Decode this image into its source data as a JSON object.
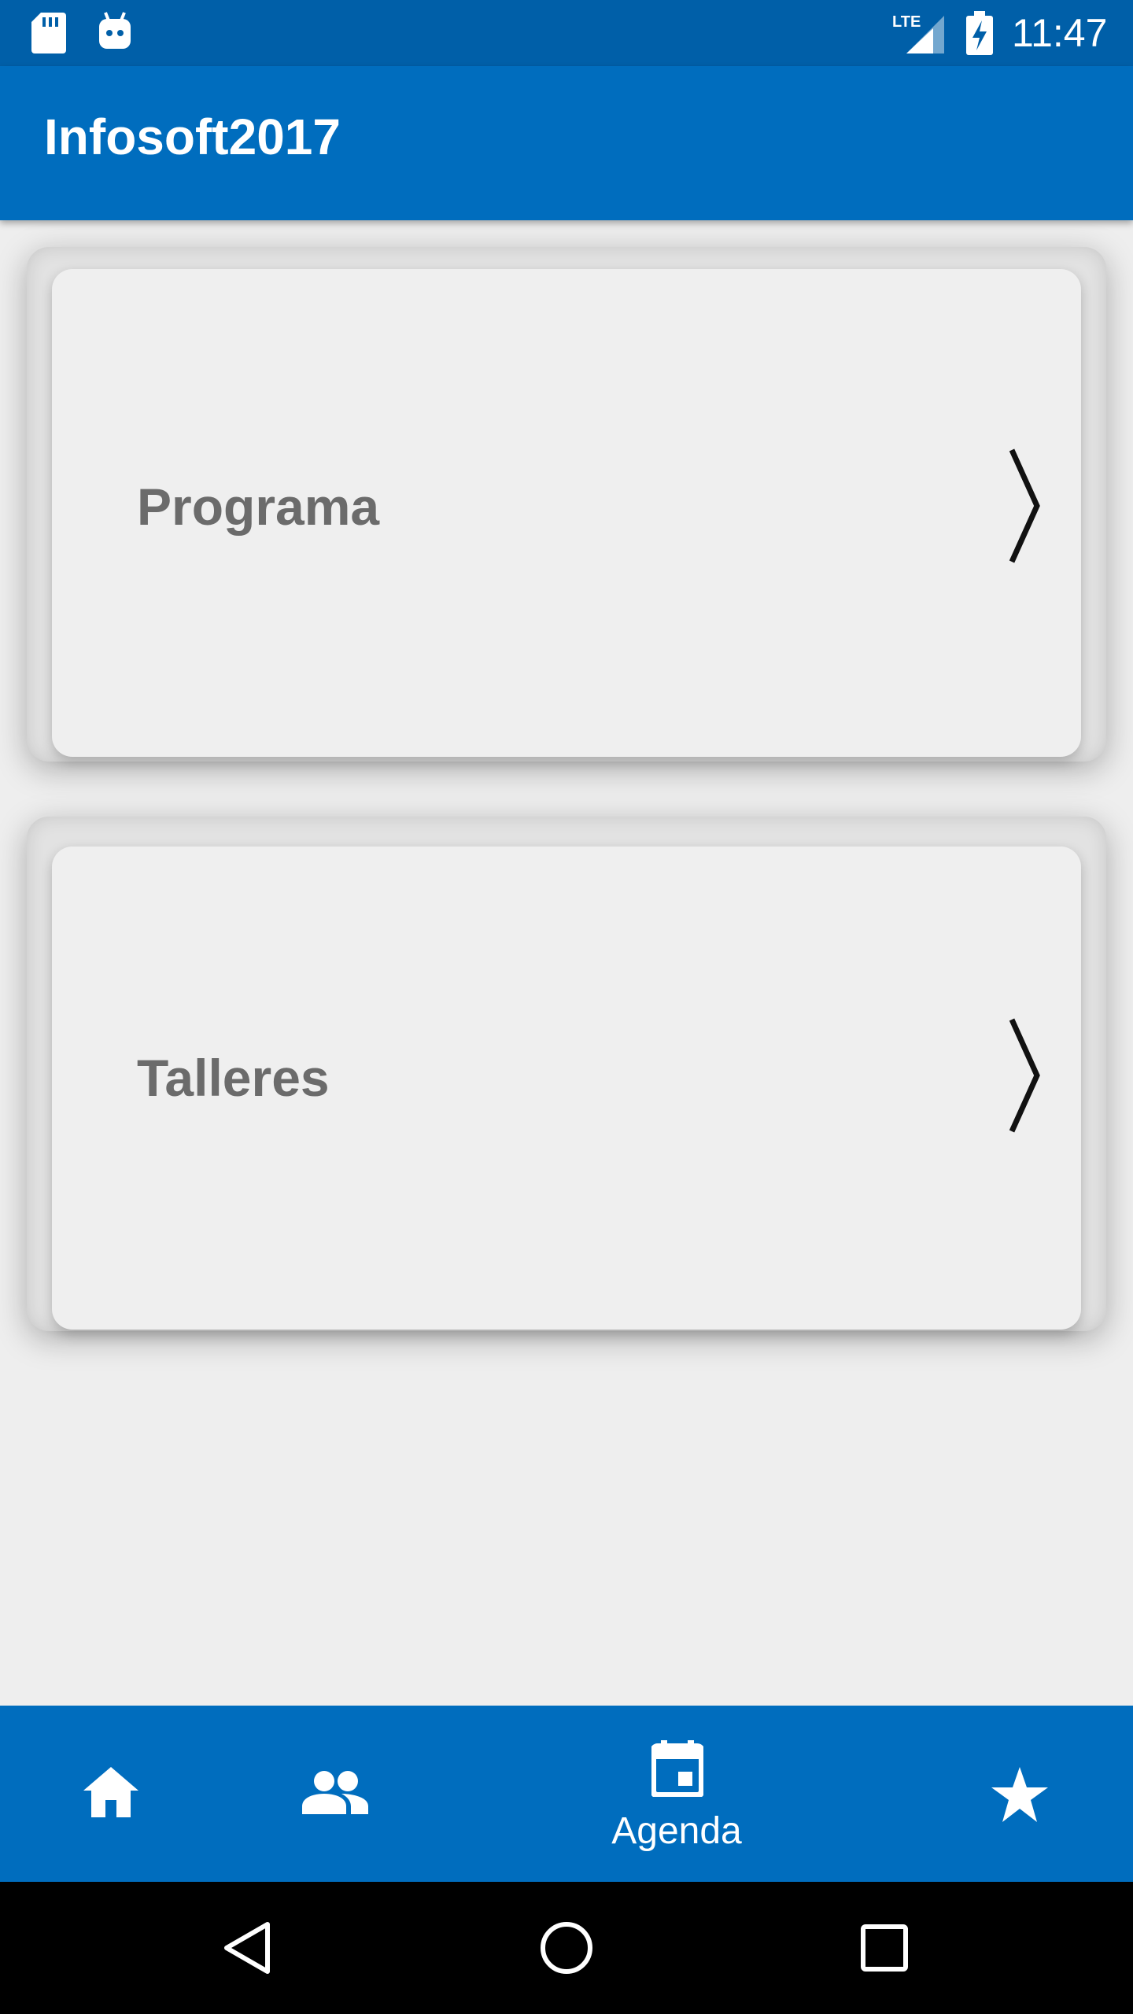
{
  "status_bar": {
    "time": "11:47",
    "network_label": "LTE",
    "icons": [
      "sd-card-icon",
      "android-bot-icon",
      "lte-signal-icon",
      "battery-charging-icon"
    ]
  },
  "app_bar": {
    "title": "Infosoft2017"
  },
  "cards": [
    {
      "label": "Programa",
      "icon": "chevron-right-icon"
    },
    {
      "label": "Talleres",
      "icon": "chevron-right-icon"
    }
  ],
  "bottom_nav": {
    "items": [
      {
        "icon": "home-icon",
        "label": ""
      },
      {
        "icon": "people-icon",
        "label": ""
      },
      {
        "icon": "calendar-icon",
        "label": "Agenda",
        "active": true
      },
      {
        "icon": "star-icon",
        "label": ""
      }
    ]
  },
  "system_nav": {
    "icons": [
      "back-icon",
      "home-circle-icon",
      "recents-icon"
    ]
  },
  "colors": {
    "primary": "#006dbe",
    "status_bar": "#005fa8",
    "background": "#eeeeee",
    "card": "#efefef",
    "card_text": "#6b6b6b"
  }
}
